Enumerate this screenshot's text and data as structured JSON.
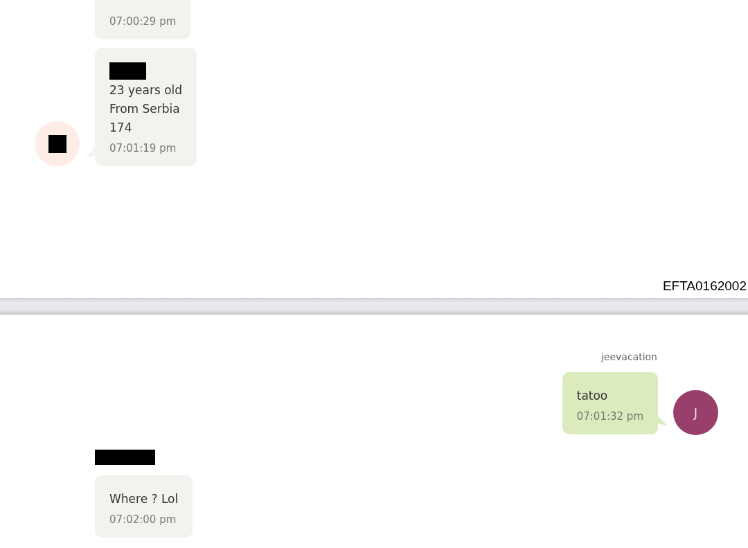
{
  "top_page": {
    "messages": [
      {
        "kind": "incoming",
        "time": "07:00:29 pm",
        "cut_top": true
      },
      {
        "kind": "incoming",
        "name_redacted": true,
        "lines": [
          "23 years old",
          "From Serbia",
          "174"
        ],
        "time": "07:01:19 pm",
        "avatar": {
          "redacted": true
        }
      }
    ]
  },
  "stamp": "EFTA0162002",
  "bottom_page": {
    "messages": [
      {
        "kind": "outgoing",
        "sender": "jeevacation",
        "lines": [
          "tatoo"
        ],
        "time": "07:01:32 pm",
        "avatar": {
          "initial": "J"
        }
      },
      {
        "kind": "incoming",
        "sender_redacted": true,
        "lines": [
          "Where ? Lol"
        ],
        "time": "07:02:00 pm"
      }
    ]
  }
}
